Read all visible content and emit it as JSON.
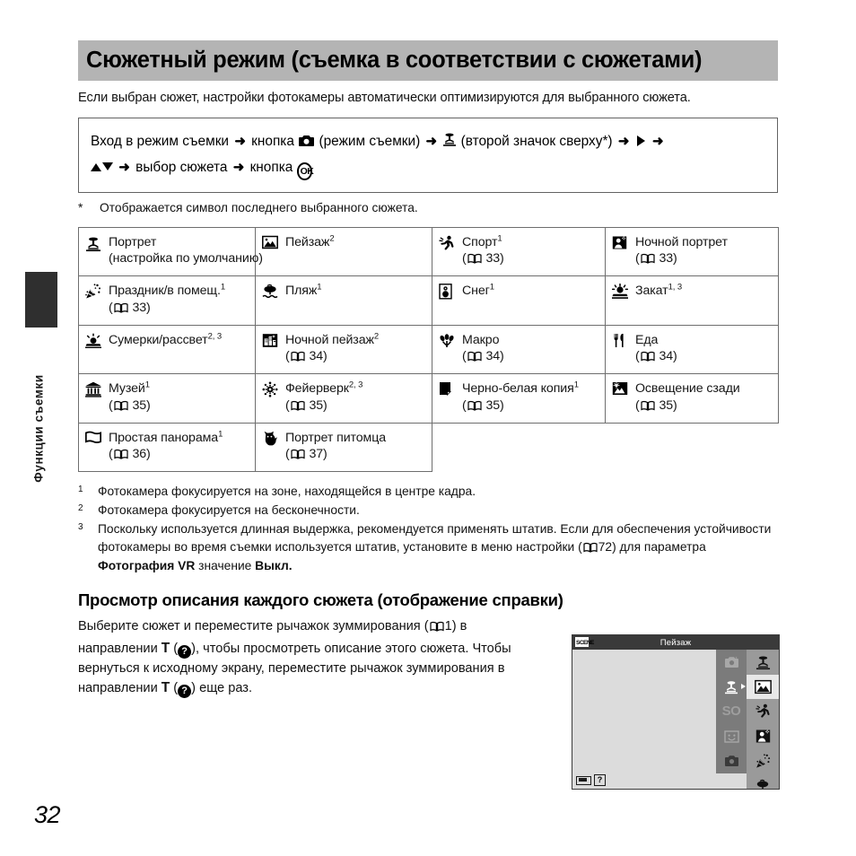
{
  "sidebar": {
    "tab_label": "Функции съемки"
  },
  "page_number": "32",
  "header": {
    "title": "Сюжетный режим (съемка в соответствии с сюжетами)"
  },
  "intro": "Если выбран сюжет, настройки фотокамеры автоматически оптимизируются для выбранного сюжета.",
  "instruction": {
    "line1_part1": "Вход в режим съемки",
    "line1_part2": "кнопка",
    "line1_part3": "(режим съемки)",
    "line1_part4": "(второй значок сверху*)",
    "line2_part1": "выбор сюжета",
    "line2_part2": "кнопка",
    "ok_label": "OK",
    "arrow": "➜"
  },
  "star_note": {
    "mark": "*",
    "text": "Отображается символ последнего выбранного сюжета."
  },
  "scene_table": {
    "rows": [
      [
        {
          "icon": "portrait-icon",
          "label": "Портрет",
          "sup": "",
          "extra": "(настройка по умолчанию)",
          "page": ""
        },
        {
          "icon": "landscape-icon",
          "label": "Пейзаж",
          "sup": "2",
          "extra": "",
          "page": ""
        },
        {
          "icon": "sports-icon",
          "label": "Спорт",
          "sup": "1",
          "extra": "",
          "page": "33"
        },
        {
          "icon": "night-portrait-icon",
          "label": "Ночной портрет",
          "sup": "",
          "extra": "",
          "page": "33"
        }
      ],
      [
        {
          "icon": "party-indoor-icon",
          "label": "Праздник/в помещ.",
          "sup": "1",
          "extra": "",
          "page": "33"
        },
        {
          "icon": "beach-icon",
          "label": "Пляж",
          "sup": "1",
          "extra": "",
          "page": ""
        },
        {
          "icon": "snow-icon",
          "label": "Снег",
          "sup": "1",
          "extra": "",
          "page": ""
        },
        {
          "icon": "sunset-icon",
          "label": "Закат",
          "sup": "1, 3",
          "extra": "",
          "page": ""
        }
      ],
      [
        {
          "icon": "dusk-dawn-icon",
          "label": "Сумерки/рассвет",
          "sup": "2, 3",
          "extra": "",
          "page": ""
        },
        {
          "icon": "night-landscape-icon",
          "label": "Ночной пейзаж",
          "sup": "2",
          "extra": "",
          "page": "34"
        },
        {
          "icon": "macro-icon",
          "label": "Макро",
          "sup": "",
          "extra": "",
          "page": "34"
        },
        {
          "icon": "food-icon",
          "label": "Еда",
          "sup": "",
          "extra": "",
          "page": "34"
        }
      ],
      [
        {
          "icon": "museum-icon",
          "label": "Музей",
          "sup": "1",
          "extra": "",
          "page": "35"
        },
        {
          "icon": "fireworks-icon",
          "label": "Фейерверк",
          "sup": "2, 3",
          "extra": "",
          "page": "35"
        },
        {
          "icon": "bw-copy-icon",
          "label": "Черно-белая копия",
          "sup": "1",
          "extra": "",
          "page": "35"
        },
        {
          "icon": "backlight-icon",
          "label": "Освещение сзади",
          "sup": "",
          "extra": "",
          "page": "35"
        }
      ],
      [
        {
          "icon": "easy-panorama-icon",
          "label": "Простая панорама",
          "sup": "1",
          "extra": "",
          "page": "36"
        },
        {
          "icon": "pet-portrait-icon",
          "label": "Портрет питомца",
          "sup": "",
          "extra": "",
          "page": "37"
        }
      ]
    ]
  },
  "footnotes": [
    {
      "num": "1",
      "text": "Фотокамера фокусируется на зоне, находящейся в центре кадра."
    },
    {
      "num": "2",
      "text": "Фотокамера фокусируется на бесконечности."
    },
    {
      "num": "3",
      "text_before": "Поскольку используется длинная выдержка, рекомендуется применять штатив. Если для обеспечения устойчивости фотокамеры во время съемки используется штатив, установите в меню настройки (",
      "page": "72",
      "text_mid": ") для параметра ",
      "bold1": "Фотография VR",
      "text_mid2": " значение ",
      "bold2": "Выкл.",
      "text_after": ""
    }
  ],
  "help_section": {
    "heading": "Просмотр описания каждого сюжета (отображение справки)",
    "body_1": "Выберите сюжет и переместите рычажок зуммирования (",
    "body_page": "1",
    "body_2": ") в направлении ",
    "t_label": "T",
    "body_3": "), чтобы просмотреть описание этого сюжета. Чтобы вернуться к исходному экрану, переместите рычажок зуммирования в направлении ",
    "body_4": ") еще раз.",
    "question_mark": "?"
  },
  "lcd": {
    "scene_badge": "SCENE",
    "title": "Пейзаж",
    "mode_items": [
      "auto-camera-icon",
      "scene-portrait-icon",
      "so-label",
      "smart-portrait-icon",
      "camera-icon"
    ],
    "so_label": "SO",
    "scene_items": [
      "portrait-icon",
      "landscape-icon",
      "sports-icon",
      "night-portrait-icon",
      "party-indoor-icon",
      "beach-icon"
    ],
    "selected_scene_index": 1,
    "current_mode_index": 1,
    "help_badge": "?"
  },
  "colors": {
    "header_band": "#b4b4b4",
    "table_border": "#6e6e6e",
    "sidebar_tab": "#2f2f2f",
    "lcd_titlebar": "#3a3a3a",
    "lcd_screen": "#dcdcdc",
    "lcd_col_mode": "#7b7b7b",
    "lcd_col_scene": "#9a9a9a",
    "lcd_selected": "#e8e8e8"
  }
}
